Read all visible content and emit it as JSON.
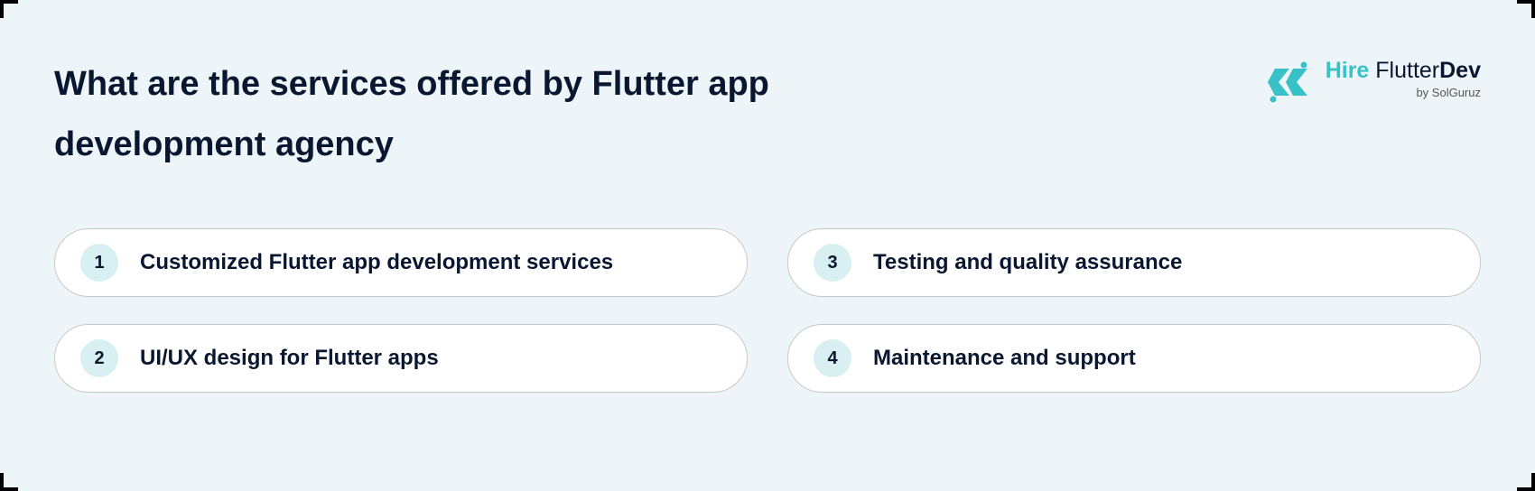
{
  "title": "What are the services offered by Flutter app development agency",
  "logo": {
    "brand_hire": "Hire",
    "brand_flutter": " Flutter",
    "brand_dev": "Dev",
    "byline": "by SolGuruz"
  },
  "services": [
    {
      "num": "1",
      "label": "Customized Flutter app development services"
    },
    {
      "num": "2",
      "label": "UI/UX design for Flutter apps"
    },
    {
      "num": "3",
      "label": "Testing and quality assurance"
    },
    {
      "num": "4",
      "label": "Maintenance and support"
    }
  ],
  "colors": {
    "accent": "#39c1c8",
    "badge_bg": "#d8f0f1",
    "page_bg": "#eef5f9",
    "text_dark": "#0a1730"
  }
}
